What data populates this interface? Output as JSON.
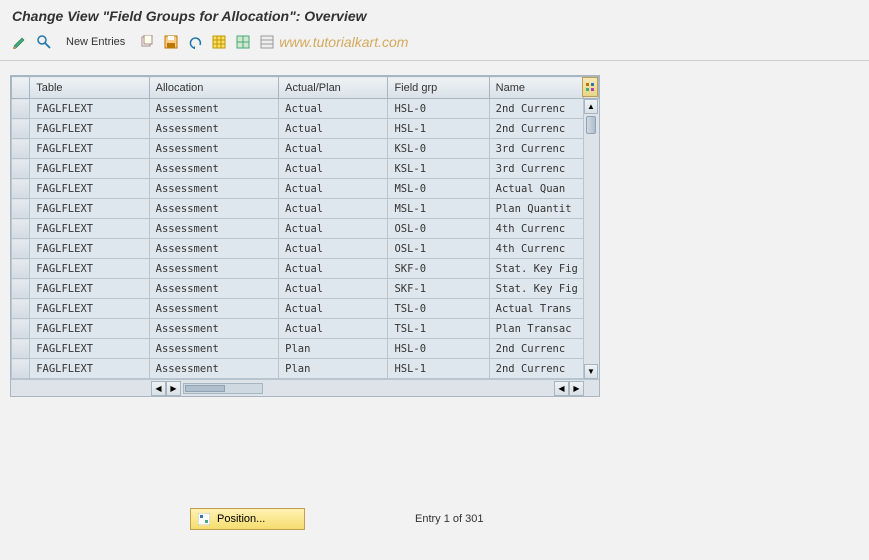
{
  "title": "Change View \"Field Groups for Allocation\": Overview",
  "toolbar": {
    "new_entries": "New Entries"
  },
  "watermark": "www.tutorialkart.com",
  "columns": {
    "c0": "",
    "c1": "Table",
    "c2": "Allocation",
    "c3": "Actual/Plan",
    "c4": "Field grp",
    "c5": "Name"
  },
  "rows": [
    {
      "table": "FAGLFLEXT",
      "alloc": "Assessment",
      "ap": "Actual",
      "fg": "HSL-0",
      "name": "2nd Currenc"
    },
    {
      "table": "FAGLFLEXT",
      "alloc": "Assessment",
      "ap": "Actual",
      "fg": "HSL-1",
      "name": "2nd Currenc"
    },
    {
      "table": "FAGLFLEXT",
      "alloc": "Assessment",
      "ap": "Actual",
      "fg": "KSL-0",
      "name": "3rd Currenc"
    },
    {
      "table": "FAGLFLEXT",
      "alloc": "Assessment",
      "ap": "Actual",
      "fg": "KSL-1",
      "name": "3rd Currenc"
    },
    {
      "table": "FAGLFLEXT",
      "alloc": "Assessment",
      "ap": "Actual",
      "fg": "MSL-0",
      "name": "Actual Quan"
    },
    {
      "table": "FAGLFLEXT",
      "alloc": "Assessment",
      "ap": "Actual",
      "fg": "MSL-1",
      "name": "Plan Quantit"
    },
    {
      "table": "FAGLFLEXT",
      "alloc": "Assessment",
      "ap": "Actual",
      "fg": "OSL-0",
      "name": "4th Currenc"
    },
    {
      "table": "FAGLFLEXT",
      "alloc": "Assessment",
      "ap": "Actual",
      "fg": "OSL-1",
      "name": "4th Currenc"
    },
    {
      "table": "FAGLFLEXT",
      "alloc": "Assessment",
      "ap": "Actual",
      "fg": "SKF-0",
      "name": "Stat. Key Fig"
    },
    {
      "table": "FAGLFLEXT",
      "alloc": "Assessment",
      "ap": "Actual",
      "fg": "SKF-1",
      "name": "Stat. Key Fig"
    },
    {
      "table": "FAGLFLEXT",
      "alloc": "Assessment",
      "ap": "Actual",
      "fg": "TSL-0",
      "name": "Actual Trans"
    },
    {
      "table": "FAGLFLEXT",
      "alloc": "Assessment",
      "ap": "Actual",
      "fg": "TSL-1",
      "name": "Plan Transac"
    },
    {
      "table": "FAGLFLEXT",
      "alloc": "Assessment",
      "ap": "Plan",
      "fg": "HSL-0",
      "name": "2nd Currenc"
    },
    {
      "table": "FAGLFLEXT",
      "alloc": "Assessment",
      "ap": "Plan",
      "fg": "HSL-1",
      "name": "2nd Currenc"
    }
  ],
  "footer": {
    "position_label": "Position...",
    "entry_text": "Entry 1 of 301"
  }
}
